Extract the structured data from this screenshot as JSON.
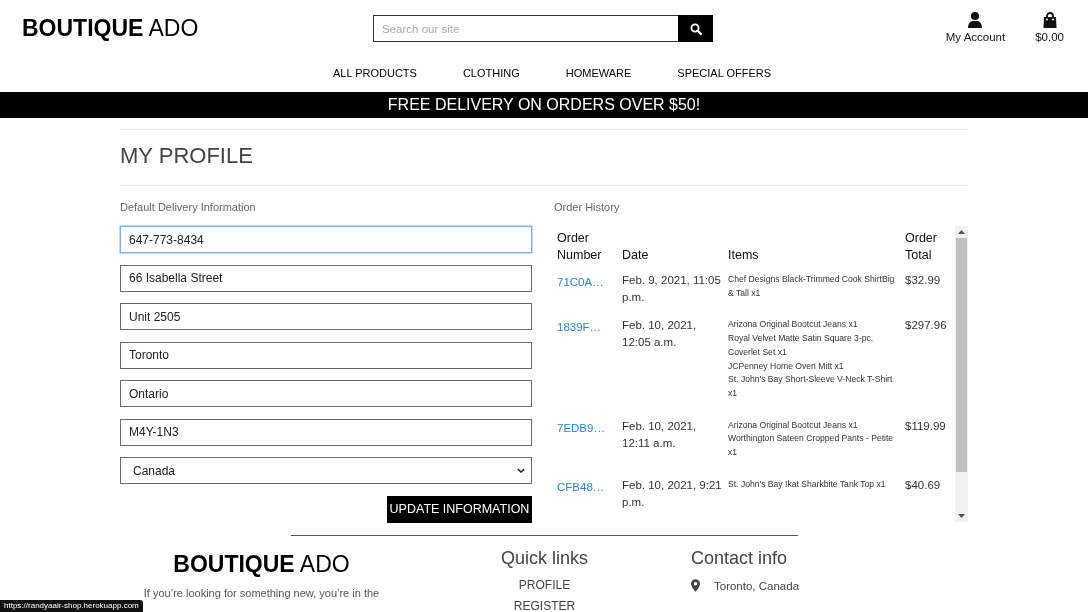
{
  "header": {
    "logo": "**BOUTIQUE** ADO",
    "search": {
      "placeholder": "Search our site"
    },
    "account_label": "My Account",
    "cart_total": "$0.00"
  },
  "nav": [
    {
      "label": "ALL PRODUCTS"
    },
    {
      "label": "CLOTHING"
    },
    {
      "label": "HOMEWARE"
    },
    {
      "label": "SPECIAL OFFERS"
    }
  ],
  "banner": "FREE DELIVERY ON ORDERS OVER $50!",
  "page_title": "MY PROFILE",
  "delivery": {
    "heading": "Default Delivery Information",
    "fields": [
      {
        "kind": "text",
        "value": "647-773-8434",
        "focused": true
      },
      {
        "kind": "text",
        "value": "66 Isabella Street",
        "focused": false
      },
      {
        "kind": "text",
        "value": "Unit 2505",
        "focused": false
      },
      {
        "kind": "text",
        "value": "Toronto",
        "focused": false
      },
      {
        "kind": "text",
        "value": "Ontario",
        "focused": false
      },
      {
        "kind": "text",
        "value": "M4Y-1N3",
        "focused": false
      },
      {
        "kind": "select",
        "value": "Canada",
        "focused": false
      }
    ],
    "submit": "UPDATE INFORMATION"
  },
  "order_history": {
    "heading": "Order History",
    "columns": [
      "Order Number",
      "Date",
      "Items",
      "Order Total"
    ],
    "rows": [
      {
        "order_number": "71C0A…",
        "date": "Feb. 9, 2021, 11:05 p.m.",
        "items": [
          "Chef Designs Black-Trimmed Cook ShirtBig & Tall x1"
        ],
        "total": "$32.99"
      },
      {
        "order_number": "1839F…",
        "date": "Feb. 10, 2021, 12:05 a.m.",
        "items": [
          "Arizona Original Bootcut Jeans x1",
          "Royal Velvet Matte Satin Square 3-pc. Coverlet Set x1",
          "JCPenney Home Oven Mitt x1",
          "St. John's Bay Short-Sleeve V-Neck T-Shirt x1"
        ],
        "total": "$297.96"
      },
      {
        "order_number": "7EDB9…",
        "date": "Feb. 10, 2021, 12:11 a.m.",
        "items": [
          "Arizona Original Bootcut Jeans x1",
          "Worthington Sateen Cropped Pants - Petite x1"
        ],
        "total": "$119.99"
      },
      {
        "order_number": "CFB48…",
        "date": "Feb. 10, 2021, 9:21 p.m.",
        "items": [
          "St. John's Bay Ikat Sharkbite Tank Top x1"
        ],
        "total": "$40.69"
      }
    ]
  },
  "footer": {
    "logo": "**BOUTIQUE** ADO",
    "text": "If you’re looking for something new, you’re in the",
    "quick_links": {
      "heading": "Quick links",
      "links": [
        "PROFILE",
        "REGISTER"
      ]
    },
    "contact": {
      "heading": "Contact info",
      "location": "Toronto, Canada"
    }
  },
  "status_url": "https://randyaair-shop.herokuapp.com"
}
